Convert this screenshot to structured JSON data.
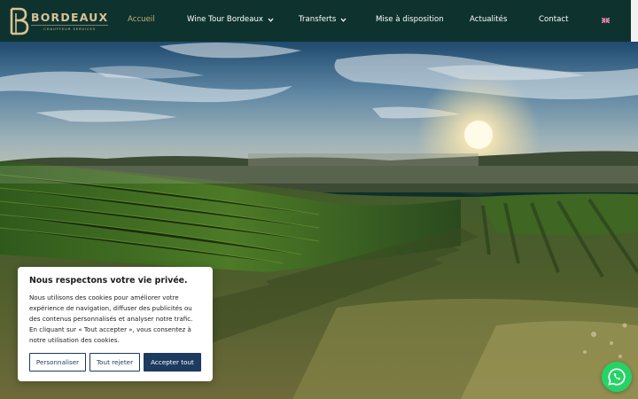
{
  "brand": {
    "title": "BORDEAUX",
    "subtitle": "CHAUFFEUR SERVICES",
    "logo_icon": "bordeaux-b-logo",
    "color_gold": "#d8c294"
  },
  "header": {
    "background": "#0e332f",
    "active_color": "#c8ad6e"
  },
  "nav": {
    "home": "Accueil",
    "wine_tour": "Wine Tour Bordeaux",
    "transfers": "Transferts",
    "disposal": "Mise à disposition",
    "news": "Actualités",
    "contact": "Contact",
    "language_icon": "uk-flag-icon"
  },
  "cookie": {
    "title": "Nous respectons votre vie privée.",
    "text": "Nous utilisons des cookies pour améliorer votre expérience de navigation, diffuser des publicités ou des contenus personnalisés et analyser notre trafic. En cliquant sur « Tout accepter », vous consentez à notre utilisation des cookies.",
    "customize_label": "Personnaliser",
    "reject_label": "Tout rejeter",
    "accept_label": "Accepter tout",
    "button_color": "#1d3a5f"
  },
  "whatsapp": {
    "icon": "whatsapp-icon",
    "color": "#25d366"
  }
}
